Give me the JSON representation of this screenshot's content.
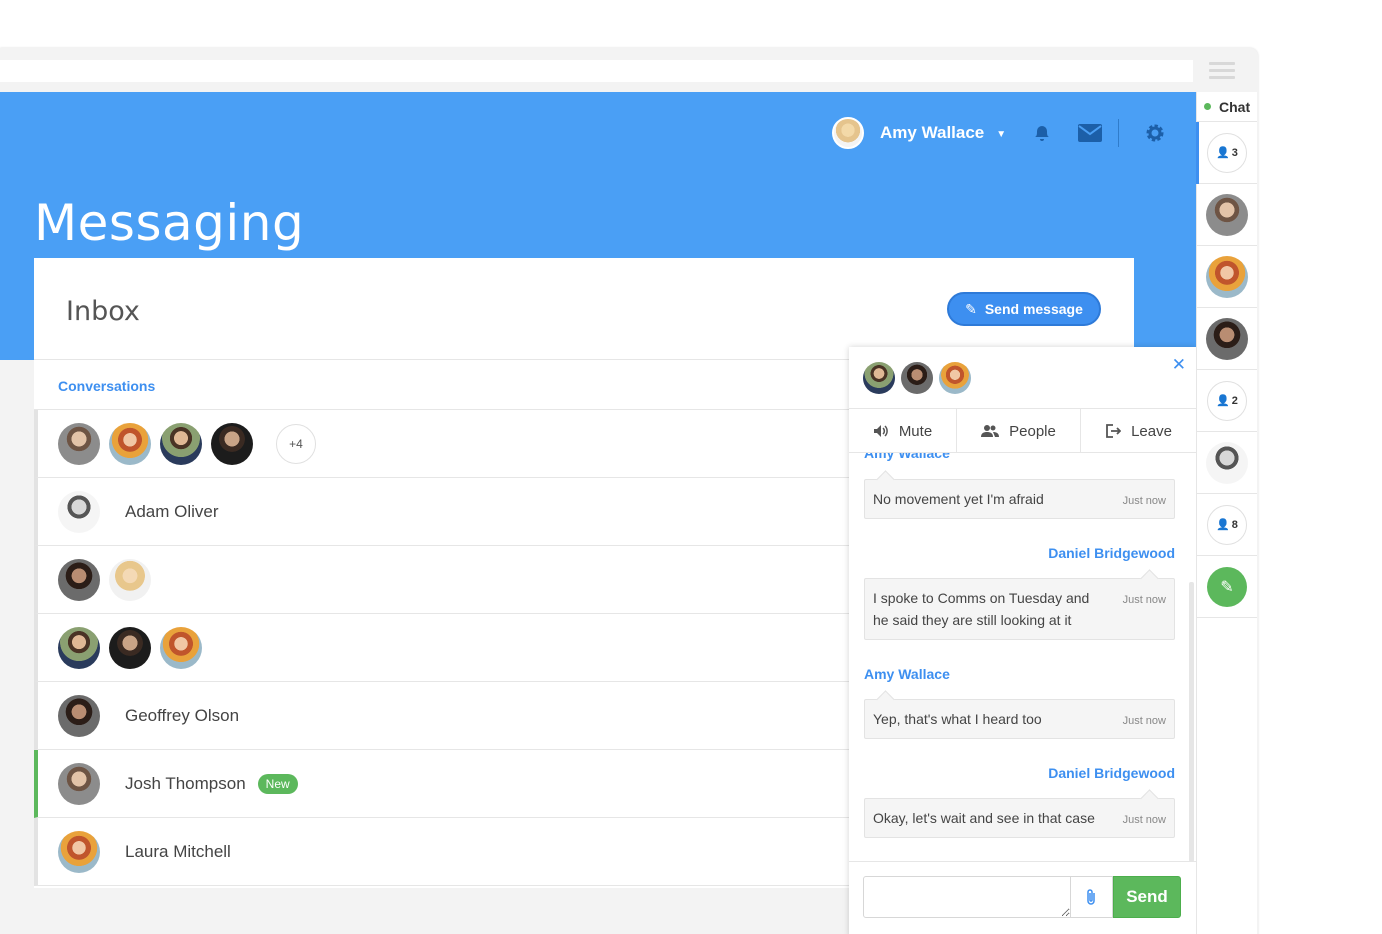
{
  "header": {
    "user_name": "Amy Wallace",
    "page_title": "Messaging"
  },
  "inbox": {
    "title": "Inbox",
    "send_message_label": "Send message",
    "tab_label": "Conversations",
    "conversations": [
      {
        "type": "group",
        "more": "+4"
      },
      {
        "type": "single",
        "name": "Adam Oliver"
      },
      {
        "type": "group"
      },
      {
        "type": "group"
      },
      {
        "type": "single",
        "name": "Geoffrey Olson"
      },
      {
        "type": "single",
        "name": "Josh Thompson",
        "badge": "New"
      },
      {
        "type": "single",
        "name": "Laura Mitchell"
      }
    ]
  },
  "chat": {
    "actions": {
      "mute": "Mute",
      "people": "People",
      "leave": "Leave"
    },
    "messages": [
      {
        "sender": "Amy Wallace",
        "text": "No movement yet I'm afraid",
        "time": "Just now"
      },
      {
        "sender": "Daniel Bridgewood",
        "text": "I spoke to Comms on Tuesday and he said they are still looking at it",
        "time": "Just now"
      },
      {
        "sender": "Amy Wallace",
        "text": "Yep, that's what I heard too",
        "time": "Just now"
      },
      {
        "sender": "Daniel Bridgewood",
        "text": "Okay, let's wait and see in that case",
        "time": "Just now"
      }
    ],
    "send_label": "Send"
  },
  "sidebar": {
    "label": "Chat",
    "groups": [
      "3",
      "2",
      "8"
    ]
  },
  "colors": {
    "brand_blue": "#4a9ff5",
    "accent_blue": "#3d8ff0",
    "success_green": "#5cb85c"
  }
}
